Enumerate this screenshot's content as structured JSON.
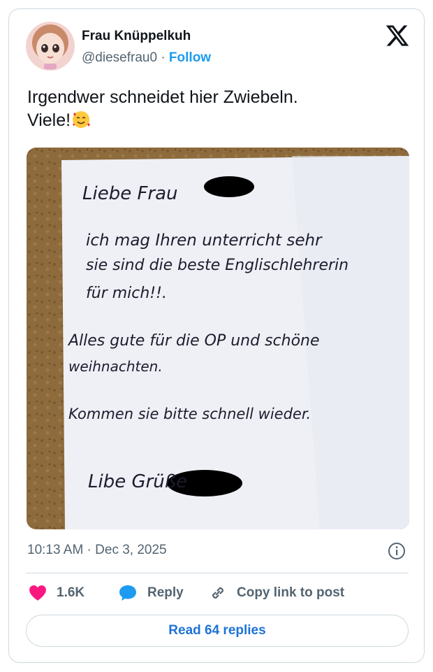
{
  "author": {
    "name": "Frau Knüppelkuh",
    "handle": "@diesefrau0",
    "separator": "·",
    "follow_label": "Follow"
  },
  "tweet": {
    "text_line1": "Irgendwer schneidet hier Zwiebeln.",
    "text_line2": "Viele!",
    "emoji": "smiling-face-with-hearts"
  },
  "note": {
    "line1": "Liebe Frau",
    "line2": "ich mag Ihren unterricht sehr",
    "line3": "sie sind die beste Englischlehrerin",
    "line4": "für mich!!.",
    "line5": "Alles gute für die OP und schöne",
    "line6": "weihnachten.",
    "line7": "Kommen sie bitte schnell wieder.",
    "line8": "Libe Grüße"
  },
  "meta": {
    "timestamp": "10:13 AM · Dec 3, 2025"
  },
  "actions": {
    "likes_count": "1.6K",
    "reply_label": "Reply",
    "copy_label": "Copy link to post"
  },
  "read_replies_label": "Read 64 replies",
  "colors": {
    "accent": "#1d9bf0",
    "heart": "#f91880",
    "text_secondary": "#536471"
  }
}
